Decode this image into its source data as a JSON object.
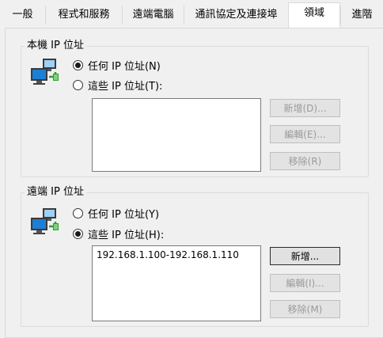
{
  "tabs": [
    {
      "label": "一般",
      "active": false
    },
    {
      "label": "程式和服務",
      "active": false
    },
    {
      "label": "遠端電腦",
      "active": false
    },
    {
      "label": "通訊協定及連接埠",
      "active": false
    },
    {
      "label": "領域",
      "active": true
    },
    {
      "label": "進階",
      "active": false
    }
  ],
  "local": {
    "title": "本機 IP 位址",
    "any_label": "任何 IP 位址(N)",
    "these_label": "這些 IP 位址(T):",
    "selected": "any",
    "entries": [],
    "add_label": "新增(D)...",
    "edit_label": "編輯(E)...",
    "remove_label": "移除(R)"
  },
  "remote": {
    "title": "遠端 IP 位址",
    "any_label": "任何 IP 位址(Y)",
    "these_label": "這些 IP 位址(H):",
    "selected": "these",
    "entries": [
      "192.168.1.100-192.168.1.110"
    ],
    "add_label": "新增...",
    "edit_label": "編輯(I)...",
    "remove_label": "移除(M)"
  },
  "icons": {
    "network": "networked-computers-icon"
  },
  "colors": {
    "monitor_screen": "#1c7fd6",
    "panel_bg": "#f0f0f0",
    "border": "#dcdcdc"
  }
}
